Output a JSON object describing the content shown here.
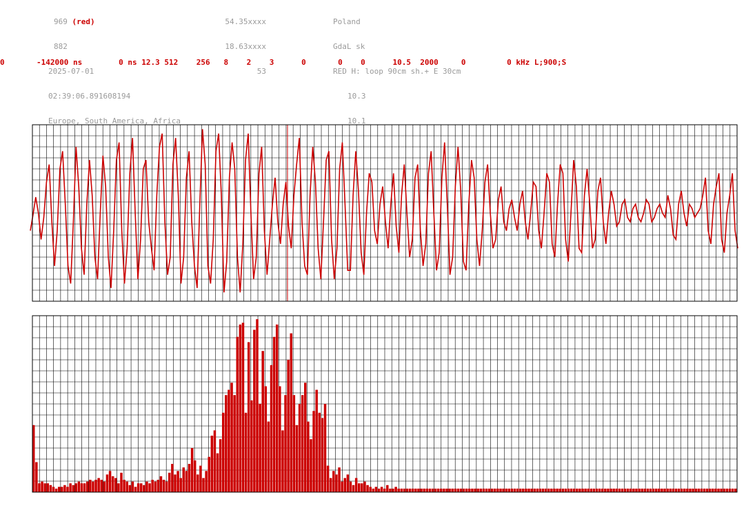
{
  "header": {
    "col1": [
      "969 ",
      "882",
      "2025-07-01",
      "02:39:06.891608194",
      "Europe, South America, Africa"
    ],
    "col1_red": "(red)",
    "col2": [
      "54.35xxxx",
      "18.63xxxx",
      "53"
    ],
    "col3": [
      "Poland",
      "GdaL sk",
      "RED H: loop 90cm sh.+ E 30cm",
      "10.3",
      "10.1"
    ]
  },
  "params_line": "0       -142000 ns        0 ns 12.3 512    256   8    2    3      0       0    0      10.5  2000     0         0 kHz L;900;S",
  "colors": {
    "trace": "#cc0000",
    "grid": "#000000",
    "muted_text": "#9a9a9a"
  },
  "chart_data": [
    {
      "type": "line",
      "title": "",
      "xlabel": "",
      "ylabel": "",
      "x_divisions": 100,
      "y_divisions": 16,
      "ylim": [
        -1,
        1
      ],
      "grid": true,
      "marker_position": 0.362,
      "series": [
        {
          "values": [
            -0.2,
            -0.02,
            0.18,
            0.0,
            -0.3,
            -0.05,
            0.35,
            0.55,
            -0.1,
            -0.6,
            -0.2,
            0.5,
            0.7,
            0.1,
            -0.6,
            -0.8,
            -0.1,
            0.75,
            0.3,
            -0.4,
            -0.7,
            0.1,
            0.6,
            0.2,
            -0.5,
            -0.75,
            0.0,
            0.65,
            0.3,
            -0.5,
            -0.85,
            -0.2,
            0.6,
            0.8,
            -0.2,
            -0.8,
            -0.4,
            0.45,
            0.85,
            0.0,
            -0.75,
            -0.3,
            0.5,
            0.6,
            -0.1,
            -0.4,
            -0.65,
            0.2,
            0.75,
            0.9,
            -0.1,
            -0.7,
            -0.5,
            0.55,
            0.85,
            0.2,
            -0.8,
            -0.5,
            0.4,
            0.7,
            -0.1,
            -0.6,
            -0.85,
            0.1,
            0.95,
            0.55,
            -0.6,
            -0.8,
            -0.3,
            0.7,
            0.9,
            0.2,
            -0.9,
            -0.55,
            0.4,
            0.8,
            0.5,
            -0.5,
            -0.9,
            -0.35,
            0.6,
            0.9,
            0.0,
            -0.75,
            -0.5,
            0.45,
            0.75,
            -0.2,
            -0.7,
            -0.3,
            0.1,
            0.4,
            -0.1,
            -0.35,
            0.1,
            0.35,
            -0.15,
            -0.4,
            0.2,
            0.55,
            0.85,
            -0.1,
            -0.6,
            -0.7,
            0.2,
            0.75,
            0.35,
            -0.4,
            -0.75,
            -0.1,
            0.6,
            0.7,
            -0.3,
            -0.75,
            -0.4,
            0.5,
            0.8,
            0.1,
            -0.65,
            -0.65,
            0.2,
            0.7,
            0.25,
            -0.45,
            -0.7,
            0.0,
            0.45,
            0.35,
            -0.2,
            -0.35,
            0.1,
            0.3,
            -0.1,
            -0.4,
            0.1,
            0.45,
            -0.15,
            -0.45,
            0.2,
            0.55,
            0.0,
            -0.5,
            -0.3,
            0.4,
            0.55,
            -0.2,
            -0.6,
            -0.35,
            0.45,
            0.7,
            0.0,
            -0.65,
            -0.45,
            0.4,
            0.8,
            0.1,
            -0.7,
            -0.5,
            0.3,
            0.75,
            0.25,
            -0.55,
            -0.65,
            0.1,
            0.6,
            0.4,
            -0.3,
            -0.6,
            -0.2,
            0.35,
            0.55,
            0.0,
            -0.4,
            -0.3,
            0.15,
            0.3,
            -0.1,
            -0.2,
            0.05,
            0.15,
            -0.05,
            -0.2,
            0.1,
            0.25,
            -0.1,
            -0.3,
            0.0,
            0.35,
            0.3,
            -0.2,
            -0.4,
            0.0,
            0.45,
            0.35,
            -0.35,
            -0.5,
            0.1,
            0.55,
            0.45,
            -0.3,
            -0.55,
            0.0,
            0.6,
            0.3,
            -0.4,
            -0.45,
            0.2,
            0.5,
            0.1,
            -0.4,
            -0.3,
            0.25,
            0.4,
            -0.1,
            -0.35,
            0.0,
            0.25,
            0.1,
            -0.15,
            -0.1,
            0.1,
            0.15,
            -0.05,
            -0.1,
            0.05,
            0.1,
            -0.05,
            -0.1,
            0.0,
            0.15,
            0.1,
            -0.1,
            -0.05,
            0.05,
            0.1,
            0.0,
            -0.05,
            0.2,
            0.05,
            -0.25,
            -0.3,
            0.1,
            0.25,
            0.0,
            -0.15,
            0.1,
            0.05,
            -0.05,
            0.0,
            0.05,
            0.2,
            0.4,
            -0.2,
            -0.35,
            0.1,
            0.3,
            0.45,
            -0.3,
            -0.45,
            0.0,
            0.2,
            0.45,
            -0.2,
            -0.4
          ],
          "color": "#cc0000"
        }
      ]
    },
    {
      "type": "bar",
      "title": "",
      "xlabel": "",
      "ylabel": "",
      "x_divisions": 100,
      "y_divisions": 16,
      "ylim": [
        0,
        1
      ],
      "grid": true,
      "values": [
        0.38,
        0.17,
        0.05,
        0.06,
        0.05,
        0.05,
        0.04,
        0.03,
        0.02,
        0.03,
        0.03,
        0.04,
        0.03,
        0.05,
        0.04,
        0.05,
        0.06,
        0.05,
        0.05,
        0.06,
        0.07,
        0.06,
        0.07,
        0.08,
        0.07,
        0.06,
        0.1,
        0.12,
        0.09,
        0.08,
        0.05,
        0.11,
        0.07,
        0.06,
        0.04,
        0.06,
        0.03,
        0.05,
        0.05,
        0.04,
        0.06,
        0.05,
        0.07,
        0.06,
        0.07,
        0.09,
        0.07,
        0.06,
        0.11,
        0.16,
        0.1,
        0.12,
        0.08,
        0.14,
        0.12,
        0.16,
        0.25,
        0.18,
        0.1,
        0.15,
        0.08,
        0.12,
        0.2,
        0.32,
        0.35,
        0.22,
        0.3,
        0.45,
        0.55,
        0.58,
        0.62,
        0.55,
        0.88,
        0.95,
        0.96,
        0.45,
        0.85,
        0.52,
        0.92,
        0.98,
        0.5,
        0.8,
        0.6,
        0.4,
        0.72,
        0.88,
        0.95,
        0.6,
        0.35,
        0.55,
        0.75,
        0.9,
        0.55,
        0.38,
        0.5,
        0.55,
        0.62,
        0.4,
        0.3,
        0.46,
        0.58,
        0.45,
        0.42,
        0.5,
        0.15,
        0.08,
        0.12,
        0.1,
        0.14,
        0.06,
        0.08,
        0.1,
        0.06,
        0.04,
        0.08,
        0.05,
        0.05,
        0.06,
        0.04,
        0.03,
        0.02,
        0.03,
        0.02,
        0.03,
        0.02,
        0.04,
        0.02,
        0.02,
        0.03,
        0.02,
        0.02,
        0.02,
        0.02,
        0.02,
        0.02,
        0.02,
        0.02,
        0.02,
        0.02,
        0.02,
        0.02,
        0.02,
        0.02,
        0.02,
        0.02,
        0.02,
        0.02,
        0.02,
        0.02,
        0.02,
        0.02,
        0.02,
        0.02,
        0.02,
        0.02,
        0.02,
        0.02,
        0.02,
        0.02,
        0.02,
        0.02,
        0.02,
        0.02,
        0.02,
        0.02,
        0.02,
        0.02,
        0.02,
        0.02,
        0.02,
        0.02,
        0.02,
        0.02,
        0.02,
        0.02,
        0.02,
        0.02,
        0.02,
        0.02,
        0.02,
        0.02,
        0.02,
        0.02,
        0.02,
        0.02,
        0.02,
        0.02,
        0.02,
        0.02,
        0.02,
        0.02,
        0.02,
        0.02,
        0.02,
        0.02,
        0.02,
        0.02,
        0.02,
        0.02,
        0.02,
        0.02,
        0.02,
        0.02,
        0.02,
        0.02,
        0.02,
        0.02,
        0.02,
        0.02,
        0.02,
        0.02,
        0.02,
        0.02,
        0.02,
        0.02,
        0.02,
        0.02,
        0.02,
        0.02,
        0.02,
        0.02,
        0.02,
        0.02,
        0.02,
        0.02,
        0.02,
        0.02,
        0.02,
        0.02,
        0.02,
        0.02,
        0.02,
        0.02,
        0.02,
        0.02,
        0.02,
        0.02,
        0.02,
        0.02,
        0.02,
        0.02,
        0.02,
        0.02,
        0.02,
        0.02,
        0.02,
        0.02,
        0.02,
        0.02
      ],
      "color": "#cc0000"
    }
  ]
}
